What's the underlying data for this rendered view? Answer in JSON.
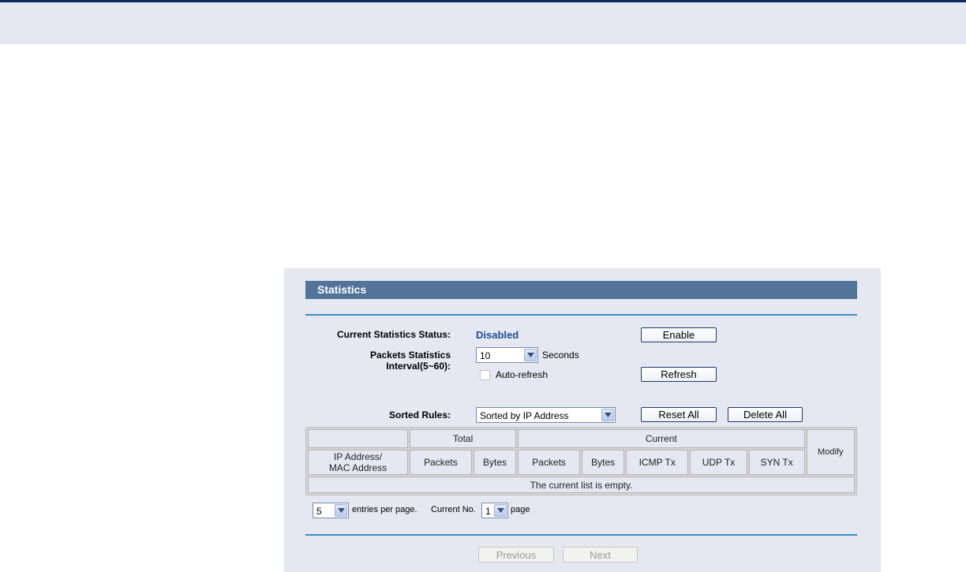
{
  "panel": {
    "title": "Statistics"
  },
  "status": {
    "label": "Current Statistics Status:",
    "value": "Disabled",
    "enable_button": "Enable"
  },
  "interval": {
    "label": "Packets Statistics Interval(5~60):",
    "selected": "10",
    "unit": "Seconds"
  },
  "auto_refresh": {
    "label": "Auto-refresh",
    "checked": false,
    "refresh_button": "Refresh"
  },
  "sorting": {
    "label": "Sorted Rules:",
    "selected": "Sorted by IP Address",
    "reset_button": "Reset All",
    "delete_button": "Delete All"
  },
  "table": {
    "group_total": "Total",
    "group_current": "Current",
    "modify": "Modify",
    "col_ip": "IP Address/",
    "col_mac": "MAC Address",
    "total_packets": "Packets",
    "total_bytes": "Bytes",
    "current_packets": "Packets",
    "current_bytes": "Bytes",
    "icmp_tx": "ICMP Tx",
    "udp_tx": "UDP Tx",
    "syn_tx": "SYN Tx",
    "empty_message": "The current list is empty."
  },
  "pagination": {
    "entries_selected": "5",
    "entries_label": "entries per page.",
    "current_label": "Current No.",
    "page_selected": "1",
    "page_label": "page",
    "previous_button": "Previous",
    "next_button": "Next"
  }
}
